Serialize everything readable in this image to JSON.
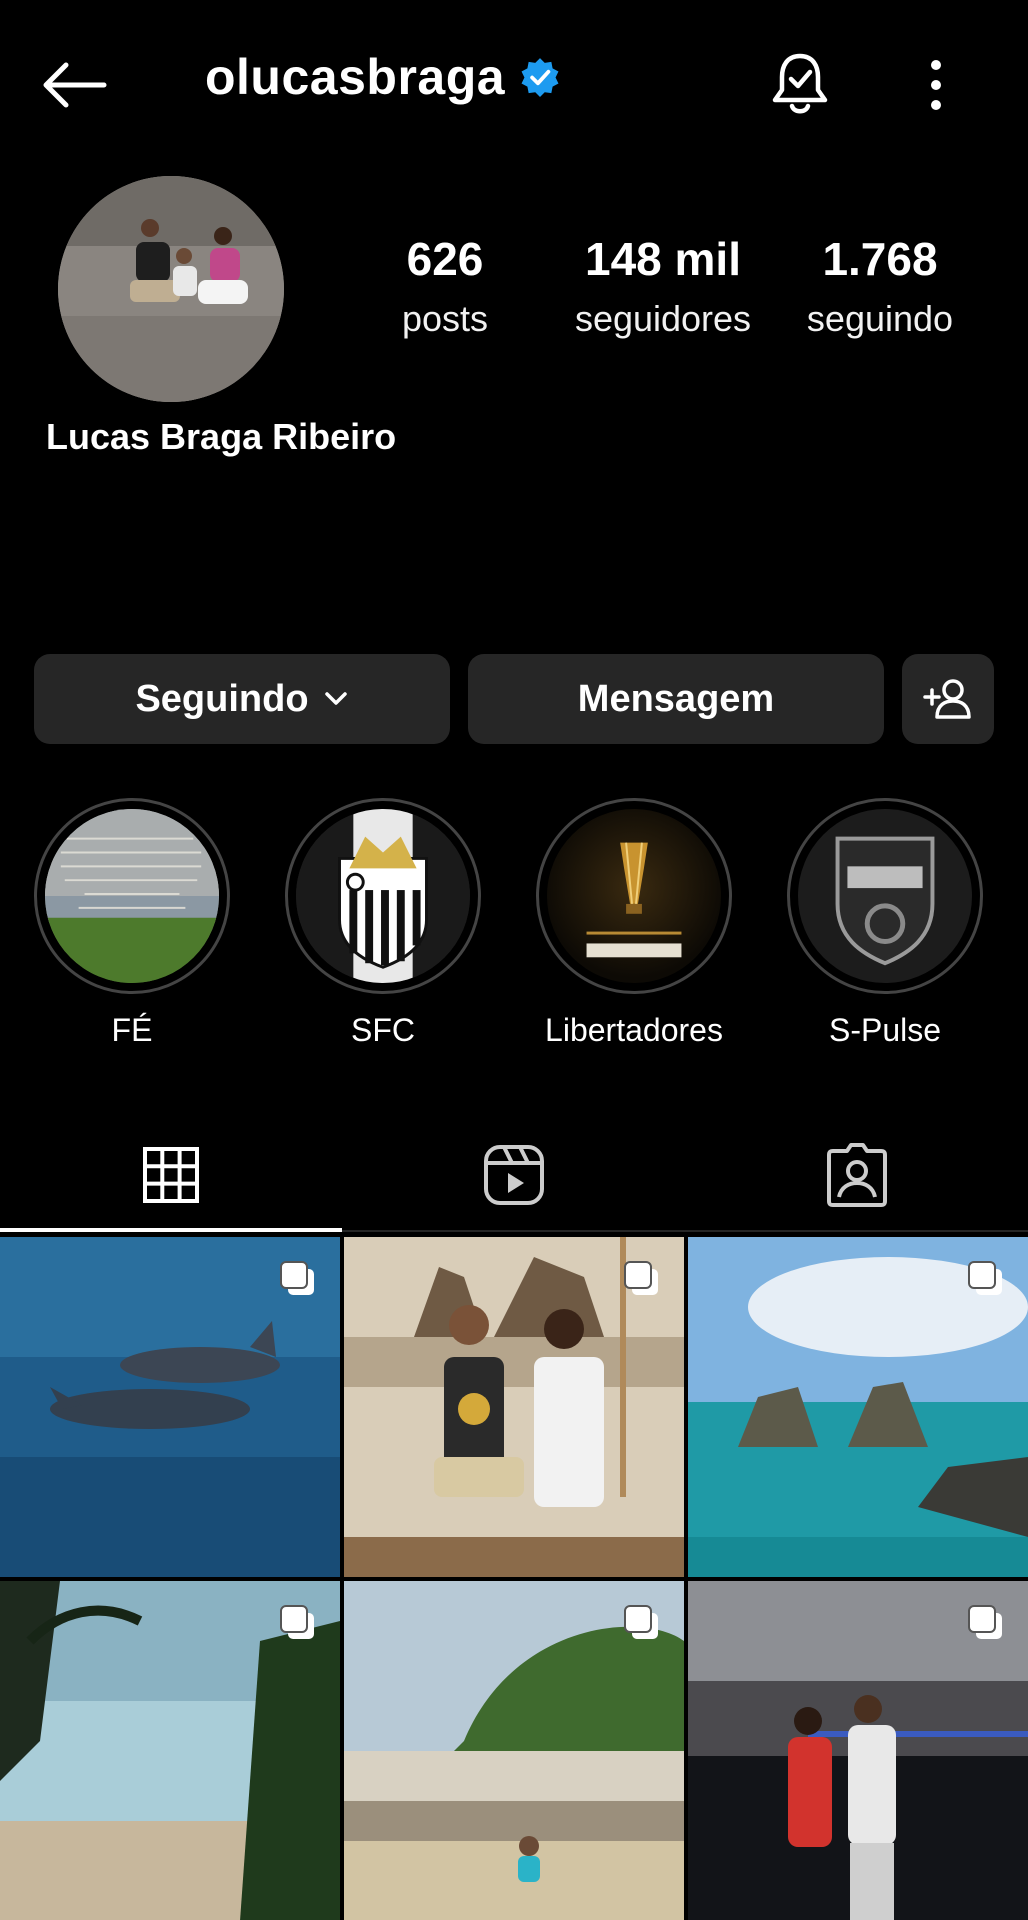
{
  "header": {
    "username": "olucasbraga",
    "back_icon": "arrow-left-icon",
    "verified_icon": "verified-badge-icon",
    "bell_icon": "bell-check-icon",
    "more_icon": "more-vertical-icon"
  },
  "profile": {
    "full_name": "Lucas Braga Ribeiro",
    "stats": [
      {
        "value": "626",
        "label": "posts"
      },
      {
        "value": "148 mil",
        "label": "seguidores"
      },
      {
        "value": "1.768",
        "label": "seguindo"
      }
    ]
  },
  "actions": {
    "following_label": "Seguindo",
    "message_label": "Mensagem",
    "add_person_icon": "add-person-icon"
  },
  "highlights": [
    {
      "label": "FÉ"
    },
    {
      "label": "SFC"
    },
    {
      "label": "Libertadores"
    },
    {
      "label": "S-Pulse"
    }
  ],
  "tabs": [
    {
      "name": "grid",
      "icon": "grid-icon",
      "active": true
    },
    {
      "name": "reels",
      "icon": "reels-icon",
      "active": false
    },
    {
      "name": "tagged",
      "icon": "tagged-icon",
      "active": false
    }
  ],
  "colors": {
    "background": "#000000",
    "button_bg": "#262626",
    "verified": "#1d9bf0"
  }
}
